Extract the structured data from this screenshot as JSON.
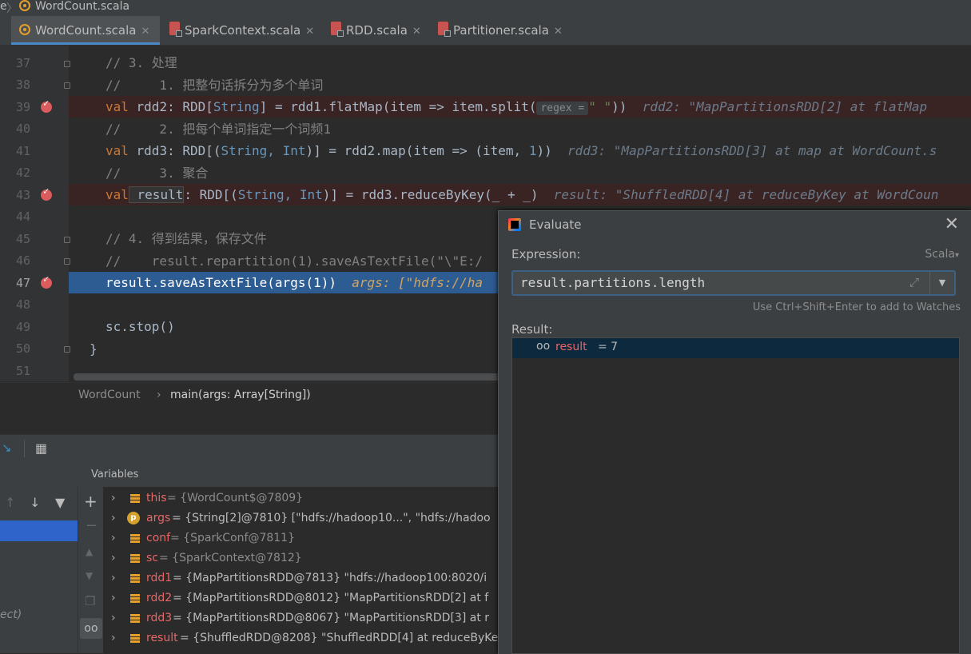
{
  "breadcrumb": {
    "parent": "e",
    "file": "WordCount.scala"
  },
  "tabs": [
    {
      "label": "WordCount.scala",
      "icon": "scala-object-icon",
      "active": true
    },
    {
      "label": "SparkContext.scala",
      "icon": "scala-class-icon"
    },
    {
      "label": "RDD.scala",
      "icon": "scala-class-icon"
    },
    {
      "label": "Partitioner.scala",
      "icon": "scala-class-icon"
    }
  ],
  "editor": {
    "line_numbers": [
      "37",
      "38",
      "39",
      "40",
      "41",
      "42",
      "43",
      "44",
      "45",
      "46",
      "47",
      "48",
      "49",
      "50",
      "51"
    ],
    "lines": {
      "l37": "// 3. 处理",
      "l38": "//     1. 把整句话拆分为多个单词",
      "l39_a": "val",
      "l39_b": " rdd2: RDD[",
      "l39_c": "String",
      "l39_d": "] = rdd1.flatMap(item => item.split(",
      "l39_hint": "regex =",
      "l39_e": "\" \"",
      "l39_f": "))",
      "l39_val": "rdd2: \"MapPartitionsRDD[2] at flatMap",
      "l40": "//     2. 把每个单词指定一个词频1",
      "l41_a": "val",
      "l41_b": " rdd3: RDD[(",
      "l41_c": "String, Int",
      "l41_d": ")] = rdd2.map(item => (item, ",
      "l41_e": "1",
      "l41_f": "))",
      "l41_val": "rdd3: \"MapPartitionsRDD[3] at map at WordCount.s",
      "l42": "//     3. 聚合",
      "l43_a": "val",
      "l43_b": " result",
      "l43_c": ": RDD[(",
      "l43_d": "String, Int",
      "l43_e": ")] = rdd3.reduceByKey(_ + _)",
      "l43_val": "result: \"ShuffledRDD[4] at reduceByKey at WordCoun",
      "l45": "// 4. 得到结果，保存文件",
      "l46": "//    result.repartition(1).saveAsTextFile(\"\\\"E:/",
      "l47": "result.saveAsTextFile(args(1))",
      "l47_val": "args: [\"hdfs://ha",
      "l49": "sc.stop()",
      "l50": "}"
    }
  },
  "method_bar": {
    "class": "WordCount",
    "method": "main(args: Array[String])"
  },
  "debugger": {
    "variables_title": "Variables",
    "frames_partial": "ect)",
    "variables": [
      {
        "name": "this",
        "rest": " = {WordCount$@7809}",
        "kind": "field"
      },
      {
        "name": "args",
        "rest": " = {String[2]@7810} [\"hdfs://hadoop10...\", \"hdfs://hadoo",
        "kind": "param"
      },
      {
        "name": "conf",
        "rest": " = {SparkConf@7811}",
        "kind": "field"
      },
      {
        "name": "sc",
        "rest": " = {SparkContext@7812}",
        "kind": "field"
      },
      {
        "name": "rdd1",
        "rest": " = {MapPartitionsRDD@7813} \"hdfs://hadoop100:8020/i",
        "kind": "field"
      },
      {
        "name": "rdd2",
        "rest": " = {MapPartitionsRDD@8012} \"MapPartitionsRDD[2] at f",
        "kind": "field"
      },
      {
        "name": "rdd3",
        "rest": " = {MapPartitionsRDD@8067} \"MapPartitionsRDD[3] at r",
        "kind": "field"
      },
      {
        "name": "result",
        "rest": " = {ShuffledRDD@8208} \"ShuffledRDD[4] at reduceByKe",
        "kind": "field"
      }
    ]
  },
  "evaluate": {
    "title": "Evaluate",
    "expression_label": "Expression:",
    "language": "Scala",
    "expression": "result.partitions.length",
    "hint": "Use Ctrl+Shift+Enter to add to Watches",
    "result_label": "Result:",
    "result_name": "result",
    "result_value": " = 7"
  }
}
